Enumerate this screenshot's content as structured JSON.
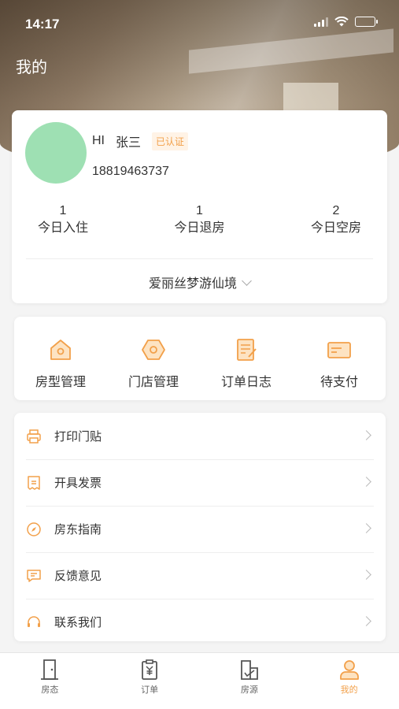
{
  "status_bar": {
    "time": "14:17"
  },
  "header": {
    "title": "我的"
  },
  "profile": {
    "greeting": "HI",
    "name": "张三",
    "verified": "已认证",
    "phone": "18819463737",
    "avatar_color": "#9ee0b3"
  },
  "stats": [
    {
      "value": "1",
      "label": "今日入住"
    },
    {
      "value": "1",
      "label": "今日退房"
    },
    {
      "value": "2",
      "label": "今日空房"
    }
  ],
  "store": {
    "name": "爱丽丝梦游仙境"
  },
  "menu": [
    {
      "label": "房型管理",
      "icon": "house-icon"
    },
    {
      "label": "门店管理",
      "icon": "hex-nut-icon"
    },
    {
      "label": "订单日志",
      "icon": "document-pen-icon"
    },
    {
      "label": "待支付",
      "icon": "card-icon"
    }
  ],
  "list": [
    {
      "label": "打印门贴",
      "icon": "printer-icon"
    },
    {
      "label": "开具发票",
      "icon": "invoice-icon"
    },
    {
      "label": "房东指南",
      "icon": "compass-icon"
    },
    {
      "label": "反馈意见",
      "icon": "message-icon"
    },
    {
      "label": "联系我们",
      "icon": "headset-icon"
    }
  ],
  "tabs": [
    {
      "label": "房态",
      "icon": "door-icon",
      "active": false
    },
    {
      "label": "订单",
      "icon": "clipboard-yen-icon",
      "active": false
    },
    {
      "label": "房源",
      "icon": "building-icon",
      "active": false
    },
    {
      "label": "我的",
      "icon": "person-icon",
      "active": true
    }
  ],
  "colors": {
    "accent": "#f2a04a",
    "accent_light": "#fde3c2",
    "text": "#333333"
  }
}
